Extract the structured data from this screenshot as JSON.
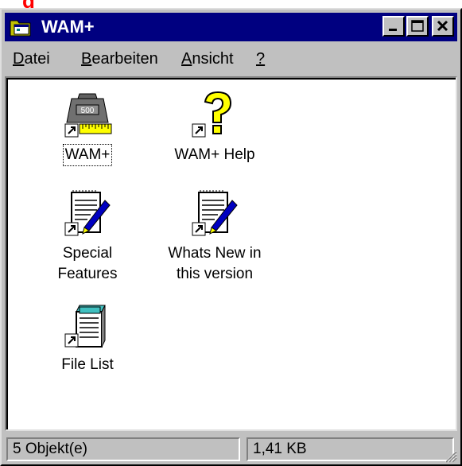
{
  "window": {
    "title": "WAM+"
  },
  "menu": {
    "items": [
      {
        "label": "Datei",
        "accel": "D",
        "rest": "atei"
      },
      {
        "label": "Bearbeiten",
        "accel": "B",
        "rest": "earbeiten"
      },
      {
        "label": "Ansicht",
        "accel": "A",
        "rest": "nsicht"
      },
      {
        "label": "?",
        "accel": "?",
        "rest": ""
      }
    ]
  },
  "icons": [
    {
      "label": "WAM+",
      "icon": "weight-shortcut-icon",
      "selected": true
    },
    {
      "label": "WAM+ Help",
      "icon": "help-question-shortcut-icon",
      "selected": false
    },
    {
      "label": "Special\nFeatures",
      "icon": "notepad-pen-shortcut-icon",
      "selected": false
    },
    {
      "label": "Whats New in\nthis version",
      "icon": "notepad-pen-shortcut-icon",
      "selected": false
    },
    {
      "label": "File List",
      "icon": "document-list-shortcut-icon",
      "selected": false
    }
  ],
  "status": {
    "objects": "5 Objekt(e)",
    "size": "1,41 KB"
  },
  "colors": {
    "titlebar": "#000080",
    "face": "#c0c0c0"
  }
}
